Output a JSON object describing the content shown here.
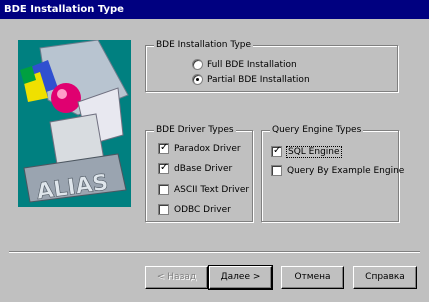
{
  "window": {
    "title": "BDE Installation Type"
  },
  "installation_type": {
    "legend": "BDE Installation Type",
    "options": [
      {
        "label": "Full BDE Installation",
        "selected": false
      },
      {
        "label": "Partial BDE Installation",
        "selected": true
      }
    ]
  },
  "driver_types": {
    "legend": "BDE Driver Types",
    "items": [
      {
        "label": "Paradox Driver",
        "checked": true
      },
      {
        "label": "dBase Driver",
        "checked": true
      },
      {
        "label": "ASCII Text Driver",
        "checked": false
      },
      {
        "label": "ODBC Driver",
        "checked": false
      }
    ]
  },
  "query_engine_types": {
    "legend": "Query Engine Types",
    "items": [
      {
        "label": "SQL Engine",
        "checked": true
      },
      {
        "label": "Query By Example Engine",
        "checked": false
      }
    ]
  },
  "artwork": {
    "label": "ALIAS"
  },
  "buttons": {
    "back": "< Назад",
    "next": "Далее >",
    "cancel": "Отмена",
    "help": "Справка"
  },
  "colors": {
    "titlebar": "#000080",
    "face": "#c0c0c0",
    "art_bg": "#008080"
  }
}
